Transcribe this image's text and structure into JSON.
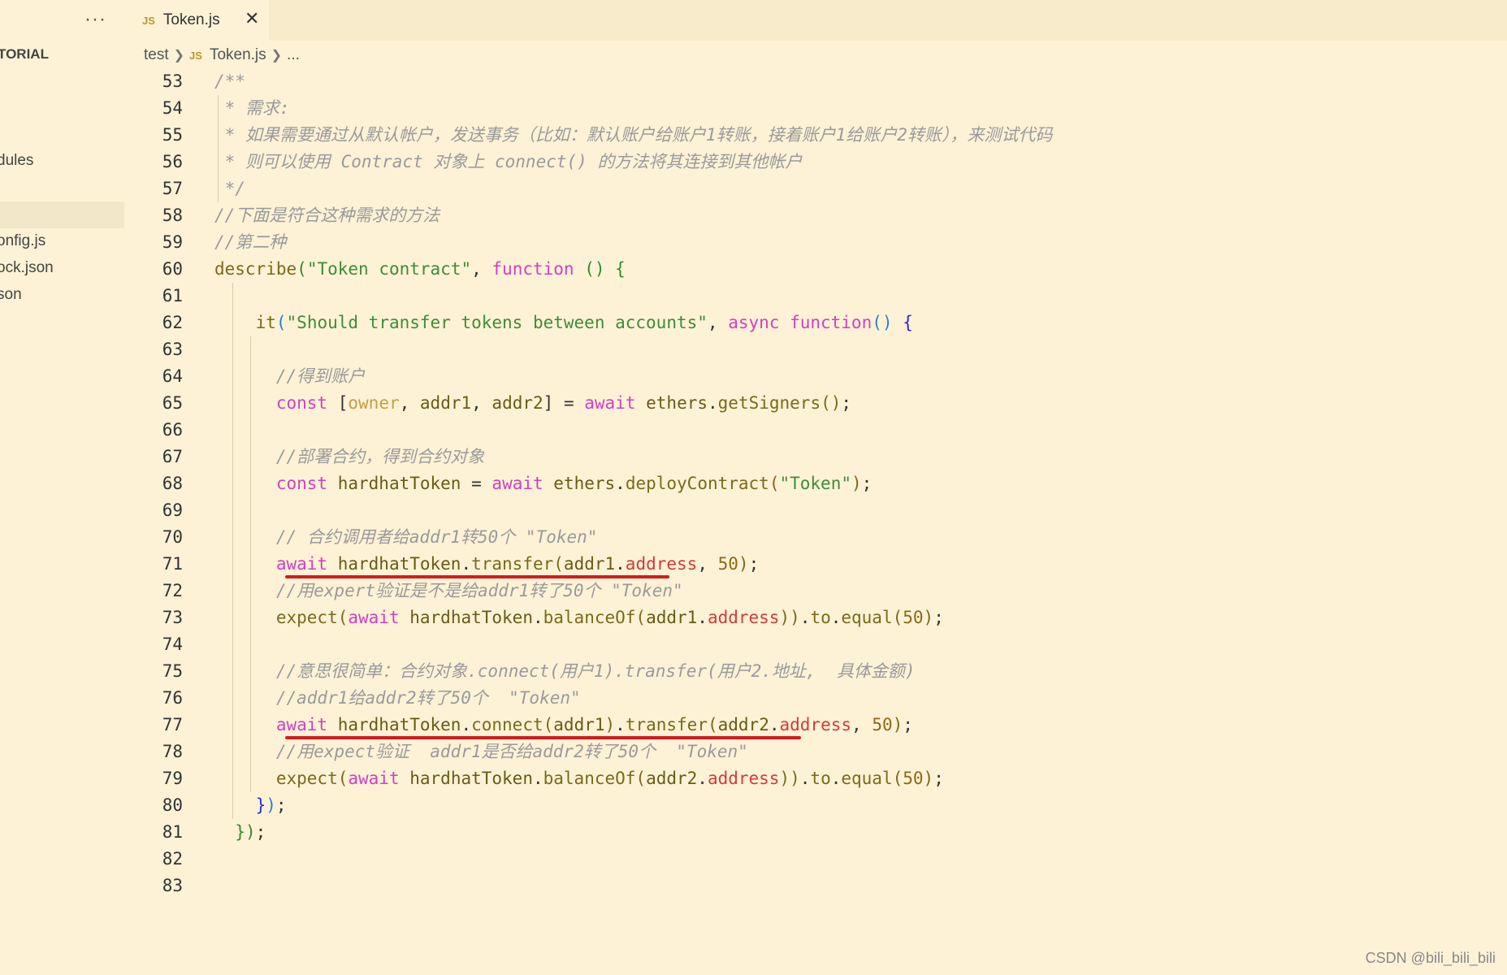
{
  "sidebar": {
    "more_label": "···",
    "section_title": "TORIAL",
    "items": [
      {
        "label": "dules"
      },
      {
        "label": "onfig.js"
      },
      {
        "label": "ock.json"
      },
      {
        "label": "son"
      }
    ]
  },
  "tab": {
    "badge": "JS",
    "label": "Token.js",
    "close": "✕"
  },
  "breadcrumb": {
    "folder": "test",
    "badge": "JS",
    "file": "Token.js",
    "more": "..."
  },
  "colors": {
    "background": "#fdf2d6",
    "comment": "#9a9a9a",
    "string": "#3f8c3a",
    "keyword": "#d43fc0",
    "underline": "#d61b1b"
  },
  "lines": [
    {
      "n": "53",
      "t": [
        "/**"
      ]
    },
    {
      "n": "54",
      "t": [
        " * 需求:"
      ]
    },
    {
      "n": "55",
      "t": [
        " * 如果需要通过从默认帐户，发送事务（比如：默认账户给账户1转账，接着账户1给账户2转账），来测试代码"
      ]
    },
    {
      "n": "56",
      "t": [
        " * 则可以使用 Contract 对象上 connect() 的方法将其连接到其他帐户"
      ]
    },
    {
      "n": "57",
      "t": [
        " */"
      ]
    },
    {
      "n": "58",
      "t": [
        "//下面是符合这种需求的方法"
      ]
    },
    {
      "n": "59",
      "t": [
        "//第二种"
      ]
    },
    {
      "n": "60",
      "t": [
        "describe",
        "(",
        "\"Token contract\"",
        ", ",
        "function",
        " ",
        "()",
        " ",
        "{"
      ]
    },
    {
      "n": "61",
      "t": []
    },
    {
      "n": "62",
      "t": [
        "    ",
        "it",
        "(",
        "\"Should transfer tokens between accounts\"",
        ", ",
        "async",
        " ",
        "function",
        "()",
        " ",
        "{"
      ]
    },
    {
      "n": "63",
      "t": []
    },
    {
      "n": "64",
      "t": [
        "      ",
        "//得到账户"
      ]
    },
    {
      "n": "65",
      "t": [
        "      ",
        "const",
        " ",
        "[",
        "owner",
        ", ",
        "addr1",
        ", ",
        "addr2",
        "]",
        " ",
        "=",
        " ",
        "await",
        " ",
        "ethers",
        ".",
        "getSigners",
        "()",
        ";"
      ]
    },
    {
      "n": "66",
      "t": []
    },
    {
      "n": "67",
      "t": [
        "      ",
        "//部署合约，得到合约对象"
      ]
    },
    {
      "n": "68",
      "t": [
        "      ",
        "const",
        " ",
        "hardhatToken",
        " ",
        "=",
        " ",
        "await",
        " ",
        "ethers",
        ".",
        "deployContract",
        "(",
        "\"Token\"",
        ")",
        ";"
      ]
    },
    {
      "n": "69",
      "t": []
    },
    {
      "n": "70",
      "t": [
        "      ",
        "// 合约调用者给addr1转50个 \"Token\""
      ]
    },
    {
      "n": "71",
      "t": [
        "      ",
        "await",
        " ",
        "hardhatToken",
        ".",
        "transfer",
        "(",
        "addr1",
        ".",
        "address",
        ", ",
        "50",
        ")",
        ";"
      ]
    },
    {
      "n": "72",
      "t": [
        "      ",
        "//用expert验证是不是给addr1转了50个 \"Token\""
      ]
    },
    {
      "n": "73",
      "t": [
        "      ",
        "expect",
        "(",
        "await",
        " ",
        "hardhatToken",
        ".",
        "balanceOf",
        "(",
        "addr1",
        ".",
        "address",
        "))",
        ".",
        "to",
        ".",
        "equal",
        "(",
        "50",
        ")",
        ";"
      ]
    },
    {
      "n": "74",
      "t": []
    },
    {
      "n": "75",
      "t": [
        "      ",
        "//意思很简单：合约对象.connect(用户1).transfer(用户2.地址,  具体金额)"
      ]
    },
    {
      "n": "76",
      "t": [
        "      ",
        "//addr1给addr2转了50个  \"Token\""
      ]
    },
    {
      "n": "77",
      "t": [
        "      ",
        "await",
        " ",
        "hardhatToken",
        ".",
        "connect",
        "(",
        "addr1",
        ")",
        ".",
        "transfer",
        "(",
        "addr2",
        ".",
        "address",
        ", ",
        "50",
        ")",
        ";"
      ]
    },
    {
      "n": "78",
      "t": [
        "      ",
        "//用expect验证  addr1是否给addr2转了50个  \"Token\""
      ]
    },
    {
      "n": "79",
      "t": [
        "      ",
        "expect",
        "(",
        "await",
        " ",
        "hardhatToken",
        ".",
        "balanceOf",
        "(",
        "addr2",
        ".",
        "address",
        "))",
        ".",
        "to",
        ".",
        "equal",
        "(",
        "50",
        ")",
        ";"
      ]
    },
    {
      "n": "80",
      "t": [
        "    ",
        "}",
        ")",
        ";"
      ]
    },
    {
      "n": "81",
      "t": [
        "  ",
        "}",
        ")",
        ";"
      ]
    },
    {
      "n": "82",
      "t": []
    },
    {
      "n": "83",
      "t": []
    }
  ],
  "watermark": "CSDN @bili_bili_bili"
}
